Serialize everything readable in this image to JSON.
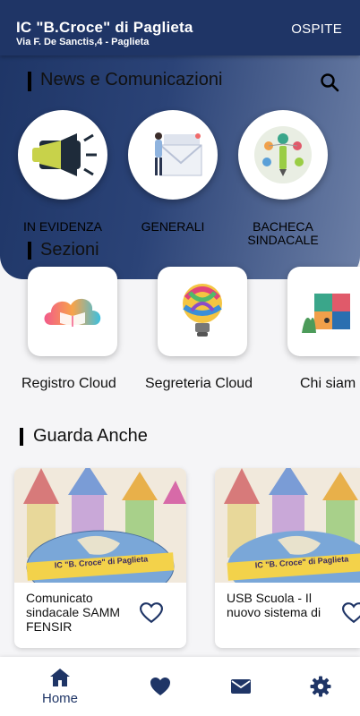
{
  "header": {
    "school_name": "IC \"B.Croce\" di Paglieta",
    "address": "Via F. De Sanctis,4 - Paglieta",
    "guest_label": "OSPITE"
  },
  "news": {
    "title": "News e Comunicazioni",
    "search_icon": "search-icon",
    "items": [
      {
        "label": "IN EVIDENZA",
        "icon": "megaphone-icon"
      },
      {
        "label": "GENERALI",
        "icon": "newsletter-icon"
      },
      {
        "label_line1": "BACHECA",
        "label_line2": "SINDACALE",
        "icon": "board-icon"
      }
    ]
  },
  "sezioni": {
    "title": "Sezioni",
    "items": [
      {
        "label": "Registro Cloud",
        "icon": "cloud-book-icon"
      },
      {
        "label": "Segreteria Cloud",
        "icon": "lightbulb-icon"
      },
      {
        "label": "Chi siam",
        "icon": "puzzle-icon"
      }
    ]
  },
  "guarda_anche": {
    "title": "Guarda Anche",
    "cards": [
      {
        "title": "Comunicato sindacale SAMM FENSIR",
        "image_text": "IC \"B. Croce\" di Paglieta"
      },
      {
        "title": "USB Scuola - Il nuovo sistema di",
        "image_text": "IC \"B. Croce\" di Paglieta"
      }
    ]
  },
  "bottom_nav": {
    "items": [
      {
        "label": "Home",
        "icon": "home-icon"
      },
      {
        "label": "",
        "icon": "heart-icon"
      },
      {
        "label": "",
        "icon": "mail-icon"
      },
      {
        "label": "",
        "icon": "gear-icon"
      }
    ]
  },
  "colors": {
    "primary": "#1f3566",
    "accent_green": "#a8c64a",
    "background": "#f5f5f7"
  }
}
